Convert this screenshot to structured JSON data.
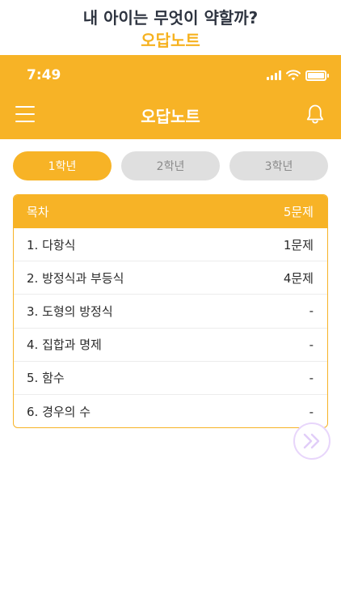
{
  "promo": {
    "title": "내 아이는 무엇이 약할까?",
    "subtitle": "오답노트"
  },
  "status_bar": {
    "time": "7:49",
    "icons": [
      "signal-icon",
      "wifi-icon",
      "battery-icon"
    ]
  },
  "nav": {
    "title": "오답노트",
    "menu_icon": "menu-icon",
    "bell_icon": "bell-icon"
  },
  "tabs": [
    {
      "label": "1학년",
      "active": true
    },
    {
      "label": "2학년",
      "active": false
    },
    {
      "label": "3학년",
      "active": false
    }
  ],
  "toc": {
    "header_label": "목차",
    "header_count": "5문제",
    "rows": [
      {
        "label": "1. 다항식",
        "count": "1문제"
      },
      {
        "label": "2. 방정식과 부등식",
        "count": "4문제"
      },
      {
        "label": "3. 도형의 방정식",
        "count": "-"
      },
      {
        "label": "4. 집합과 명제",
        "count": "-"
      },
      {
        "label": "5. 함수",
        "count": "-"
      },
      {
        "label": "6. 경우의 수",
        "count": "-"
      }
    ]
  },
  "next_button_icon": "double-chevron-right-icon",
  "colors": {
    "accent": "#f7b326",
    "inactive_tab": "#dfdfdf",
    "promo_title": "#2e3440",
    "fab_border": "#e8d6fb"
  }
}
